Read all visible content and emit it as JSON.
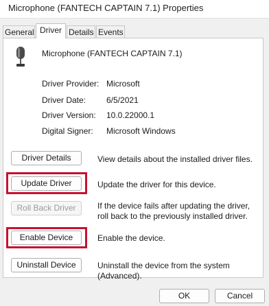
{
  "window": {
    "title": "Microphone (FANTECH CAPTAIN 7.1) Properties"
  },
  "tabs": [
    {
      "label": "General",
      "active": false
    },
    {
      "label": "Driver",
      "active": true
    },
    {
      "label": "Details",
      "active": false
    },
    {
      "label": "Events",
      "active": false
    }
  ],
  "device": {
    "name": "Microphone (FANTECH CAPTAIN 7.1)",
    "icon": "microphone-icon"
  },
  "info": [
    {
      "label": "Driver Provider:",
      "value": "Microsoft"
    },
    {
      "label": "Driver Date:",
      "value": "6/5/2021"
    },
    {
      "label": "Driver Version:",
      "value": "10.0.22000.1"
    },
    {
      "label": "Digital Signer:",
      "value": "Microsoft Windows"
    }
  ],
  "actions": [
    {
      "label": "Driver Details",
      "description": "View details about the installed driver files.",
      "enabled": true,
      "highlighted": false
    },
    {
      "label": "Update Driver",
      "description": "Update the driver for this device.",
      "enabled": true,
      "highlighted": true
    },
    {
      "label": "Roll Back Driver",
      "description": "If the device fails after updating the driver, roll back to the previously installed driver.",
      "enabled": false,
      "highlighted": false
    },
    {
      "label": "Enable Device",
      "description": "Enable the device.",
      "enabled": true,
      "highlighted": true
    },
    {
      "label": "Uninstall Device",
      "description": "Uninstall the device from the system (Advanced).",
      "enabled": true,
      "highlighted": false
    }
  ],
  "footer": {
    "ok_label": "OK",
    "cancel_label": "Cancel"
  },
  "colors": {
    "highlight": "#c8102e",
    "window_bg": "#f0f0f0",
    "panel_bg": "#ffffff"
  }
}
